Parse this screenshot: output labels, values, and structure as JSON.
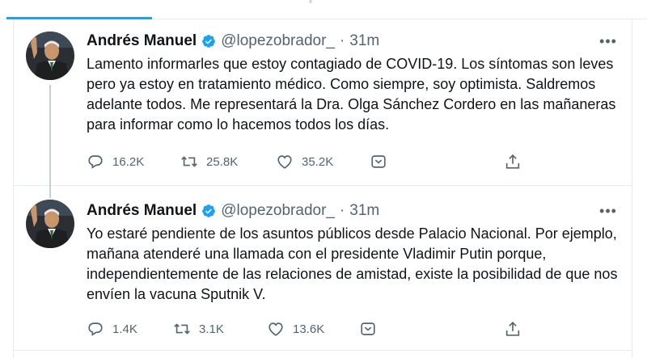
{
  "colors": {
    "accent": "#1da1f2",
    "text": "#0f1419",
    "muted": "#536471",
    "border": "#e6ecf0"
  },
  "tweets": [
    {
      "name": "Andrés Manuel",
      "handle": "@lopezobrador_",
      "separator": "·",
      "time": "31m",
      "more": "•••",
      "text": "Lamento informarles que estoy contagiado de COVID-19. Los síntomas son leves pero ya estoy en tratamiento médico. Como siempre, soy optimista. Saldremos adelante todos. Me representará la Dra. Olga Sánchez Cordero en las mañaneras para informar como lo hacemos todos los días.",
      "replies": "16.2K",
      "retweets": "25.8K",
      "likes": "35.2K",
      "icons": [
        "reply-icon",
        "retweet-icon",
        "like-icon",
        "direct-message-icon",
        "share-icon"
      ]
    },
    {
      "name": "Andrés Manuel",
      "handle": "@lopezobrador_",
      "separator": "·",
      "time": "31m",
      "more": "•••",
      "text": "Yo estaré pendiente de los asuntos públicos desde Palacio Nacional. Por ejemplo, mañana atenderé una llamada con el presidente Vladimir Putin porque, independientemente de las relaciones de amistad, existe la posibilidad de que nos envíen la vacuna Sputnik V.",
      "replies": "1.4K",
      "retweets": "3.1K",
      "likes": "13.6K",
      "icons": [
        "reply-icon",
        "retweet-icon",
        "like-icon",
        "direct-message-icon",
        "share-icon"
      ]
    }
  ]
}
